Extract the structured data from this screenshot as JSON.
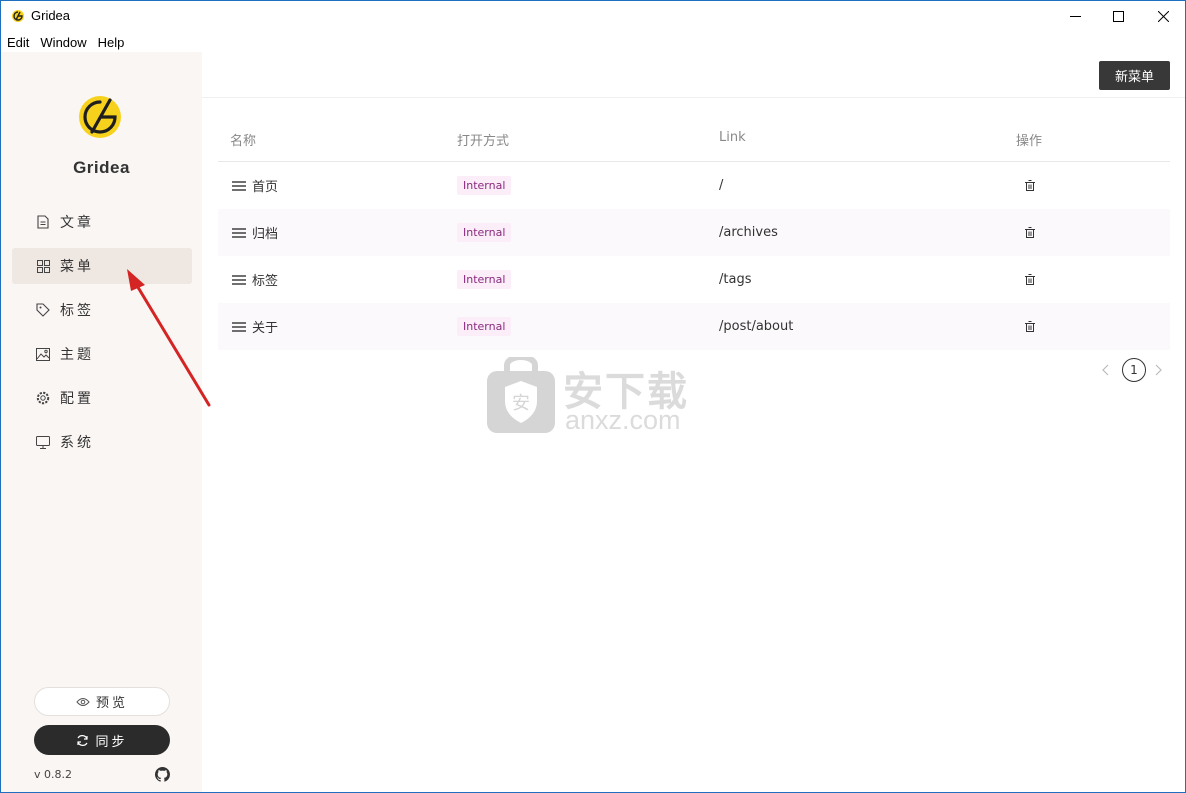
{
  "window": {
    "title": "Gridea"
  },
  "menubar": {
    "items": [
      "Edit",
      "Window",
      "Help"
    ]
  },
  "sidebar": {
    "brand": "Gridea",
    "nav": [
      {
        "label": "文章",
        "icon": "document-icon",
        "active": false
      },
      {
        "label": "菜单",
        "icon": "grid-icon",
        "active": true
      },
      {
        "label": "标签",
        "icon": "tag-icon",
        "active": false
      },
      {
        "label": "主题",
        "icon": "image-icon",
        "active": false
      },
      {
        "label": "配置",
        "icon": "gear-icon",
        "active": false
      },
      {
        "label": "系统",
        "icon": "monitor-icon",
        "active": false
      }
    ],
    "preview_label": "预览",
    "sync_label": "同步",
    "version": "v 0.8.2"
  },
  "main": {
    "new_menu_label": "新菜单",
    "columns": [
      "名称",
      "打开方式",
      "Link",
      "操作"
    ],
    "rows": [
      {
        "name": "首页",
        "open_type": "Internal",
        "link": "/"
      },
      {
        "name": "归档",
        "open_type": "Internal",
        "link": "/archives"
      },
      {
        "name": "标签",
        "open_type": "Internal",
        "link": "/tags"
      },
      {
        "name": "关于",
        "open_type": "Internal",
        "link": "/post/about"
      }
    ],
    "pagination": {
      "current": "1"
    }
  },
  "watermark": {
    "text": "安下载",
    "sub": "anxz.com"
  },
  "colors": {
    "accent_dark": "#383838",
    "sidebar_bg": "#faf6f4",
    "active_bg": "#efe7e2",
    "tag_text": "#8a2a80",
    "tag_bg": "#fbeef8",
    "logo_yellow": "#f7d21c",
    "arrow_red": "#d42424"
  }
}
